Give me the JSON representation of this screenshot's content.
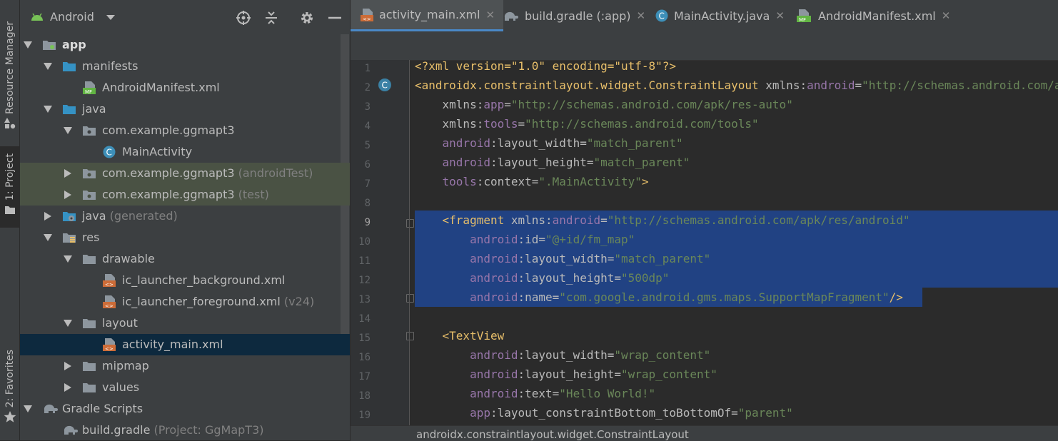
{
  "left_strip": {
    "tabs": [
      {
        "label": "Resource Manager"
      },
      {
        "label": "1: Project"
      },
      {
        "label": "2: Favorites"
      }
    ]
  },
  "project_panel": {
    "view_selector": "Android",
    "tree": [
      {
        "label": "app",
        "extra": "",
        "bold": true
      },
      {
        "label": "manifests",
        "extra": ""
      },
      {
        "label": "AndroidManifest.xml",
        "extra": ""
      },
      {
        "label": "java",
        "extra": ""
      },
      {
        "label": "com.example.ggmapt3",
        "extra": ""
      },
      {
        "label": "MainActivity",
        "extra": ""
      },
      {
        "label": "com.example.ggmapt3",
        "extra": "(androidTest)"
      },
      {
        "label": "com.example.ggmapt3",
        "extra": "(test)"
      },
      {
        "label": "java",
        "extra": "(generated)"
      },
      {
        "label": "res",
        "extra": ""
      },
      {
        "label": "drawable",
        "extra": ""
      },
      {
        "label": "ic_launcher_background.xml",
        "extra": ""
      },
      {
        "label": "ic_launcher_foreground.xml",
        "extra": "(v24)"
      },
      {
        "label": "layout",
        "extra": ""
      },
      {
        "label": "activity_main.xml",
        "extra": ""
      },
      {
        "label": "mipmap",
        "extra": ""
      },
      {
        "label": "values",
        "extra": ""
      },
      {
        "label": "Gradle Scripts",
        "extra": ""
      },
      {
        "label": "build.gradle",
        "extra": "(Project: GgMapT3)"
      }
    ]
  },
  "editor": {
    "tabs": [
      {
        "label": "activity_main.xml",
        "active": true
      },
      {
        "label": "build.gradle (:app)",
        "active": false
      },
      {
        "label": "MainActivity.java",
        "active": false
      },
      {
        "label": "AndroidManifest.xml",
        "active": false
      }
    ],
    "line_numbers": [
      "1",
      "2",
      "3",
      "4",
      "5",
      "6",
      "7",
      "8",
      "9",
      "10",
      "11",
      "12",
      "13",
      "14",
      "15",
      "16",
      "17",
      "18",
      "19"
    ],
    "lines": [
      [
        {
          "t": "<?xml version=\"1.0\" encoding=\"utf-8\"?>",
          "c": "tag"
        }
      ],
      [
        {
          "t": "<androidx.constraintlayout.widget.ConstraintLayout ",
          "c": "tag"
        },
        {
          "t": "xmlns:",
          "c": "attr"
        },
        {
          "t": "android",
          "c": "ns"
        },
        {
          "t": "=",
          "c": "attr"
        },
        {
          "t": "\"http://schemas.android.com/apk/res/android\"",
          "c": "str"
        }
      ],
      [
        {
          "t": "    xmlns:",
          "c": "attr"
        },
        {
          "t": "app",
          "c": "ns"
        },
        {
          "t": "=",
          "c": "attr"
        },
        {
          "t": "\"http://schemas.android.com/apk/res-auto\"",
          "c": "str"
        }
      ],
      [
        {
          "t": "    xmlns:",
          "c": "attr"
        },
        {
          "t": "tools",
          "c": "ns"
        },
        {
          "t": "=",
          "c": "attr"
        },
        {
          "t": "\"http://schemas.android.com/tools\"",
          "c": "str"
        }
      ],
      [
        {
          "t": "    android",
          "c": "ns"
        },
        {
          "t": ":layout_width=",
          "c": "attr"
        },
        {
          "t": "\"match_parent\"",
          "c": "str"
        }
      ],
      [
        {
          "t": "    android",
          "c": "ns"
        },
        {
          "t": ":layout_height=",
          "c": "attr"
        },
        {
          "t": "\"match_parent\"",
          "c": "str"
        }
      ],
      [
        {
          "t": "    tools",
          "c": "ns"
        },
        {
          "t": ":context=",
          "c": "attr"
        },
        {
          "t": "\".MainActivity\"",
          "c": "str"
        },
        {
          "t": ">",
          "c": "tag"
        }
      ],
      [
        {
          "t": "",
          "c": "attr"
        }
      ],
      [
        {
          "t": "    <fragment ",
          "c": "tag"
        },
        {
          "t": "xmlns:",
          "c": "attr"
        },
        {
          "t": "android",
          "c": "ns"
        },
        {
          "t": "=",
          "c": "attr"
        },
        {
          "t": "\"http://schemas.android.com/apk/res/android\"",
          "c": "str"
        }
      ],
      [
        {
          "t": "        android",
          "c": "ns"
        },
        {
          "t": ":id=",
          "c": "attr"
        },
        {
          "t": "\"@+id/fm_map\"",
          "c": "str"
        }
      ],
      [
        {
          "t": "        android",
          "c": "ns"
        },
        {
          "t": ":layout_width=",
          "c": "attr"
        },
        {
          "t": "\"match_parent\"",
          "c": "str"
        }
      ],
      [
        {
          "t": "        android",
          "c": "ns"
        },
        {
          "t": ":layout_height=",
          "c": "attr"
        },
        {
          "t": "\"500dp\"",
          "c": "str"
        }
      ],
      [
        {
          "t": "        android",
          "c": "ns"
        },
        {
          "t": ":name=",
          "c": "attr"
        },
        {
          "t": "\"com.google.android.gms.maps.SupportMapFragment\"",
          "c": "str"
        },
        {
          "t": "/>",
          "c": "tag"
        }
      ],
      [
        {
          "t": "",
          "c": "attr"
        }
      ],
      [
        {
          "t": "    <TextView",
          "c": "tag"
        }
      ],
      [
        {
          "t": "        android",
          "c": "ns"
        },
        {
          "t": ":layout_width=",
          "c": "attr"
        },
        {
          "t": "\"wrap_content\"",
          "c": "str"
        }
      ],
      [
        {
          "t": "        android",
          "c": "ns"
        },
        {
          "t": ":layout_height=",
          "c": "attr"
        },
        {
          "t": "\"wrap_content\"",
          "c": "str"
        }
      ],
      [
        {
          "t": "        android",
          "c": "ns"
        },
        {
          "t": ":text=",
          "c": "attr"
        },
        {
          "t": "\"Hello World!\"",
          "c": "str"
        }
      ],
      [
        {
          "t": "        app",
          "c": "ns"
        },
        {
          "t": ":layout_constraintBottom_toBottomOf=",
          "c": "attr"
        },
        {
          "t": "\"parent\"",
          "c": "str"
        }
      ]
    ]
  },
  "status_breadcrumb": "androidx.constraintlayout.widget.ConstraintLayout",
  "colors": {
    "accent": "#4a88c7",
    "selection": "#214283",
    "tag": "#e8bf6a",
    "namespace": "#9876aa",
    "string": "#6a8759"
  }
}
